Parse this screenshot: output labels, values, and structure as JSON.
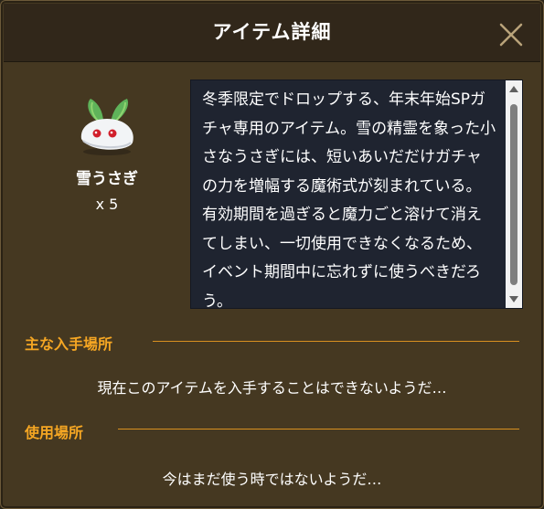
{
  "dialog": {
    "title": "アイテム詳細",
    "close_icon": "close-icon"
  },
  "item": {
    "icon": "snow-rabbit-icon",
    "name": "雪うさぎ",
    "quantity": "x 5",
    "description": "冬季限定でドロップする、年末年始SPガチャ専用のアイテム。雪の精霊を象った小さなうさぎには、短いあいだだけガチャの力を増幅する魔術式が刻まれている。有効期間を過ぎると魔力ごと溶けて消えてしまい、一切使用できなくなるため、イベント期間中に忘れずに使うべきだろう。"
  },
  "sections": {
    "acquire": {
      "heading": "主な入手場所",
      "text": "現在このアイテムを入手することはできないようだ…"
    },
    "usage": {
      "heading": "使用場所",
      "text": "今はまだ使う時ではないようだ…"
    }
  },
  "colors": {
    "accent": "#f5a623",
    "panel": "#453821",
    "titlebar": "#31271a",
    "desc_bg": "#1f2430"
  }
}
